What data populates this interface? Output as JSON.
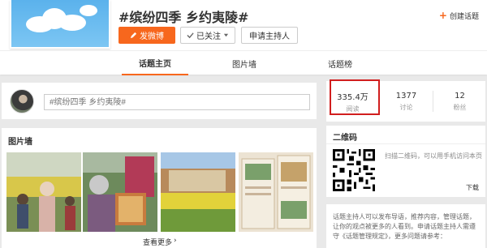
{
  "header": {
    "topic_title": "#缤纷四季 乡约夷陵#",
    "post_button": "发微博",
    "follow_button": "已关注",
    "host_button": "申请主持人",
    "create_topic": "创建话题"
  },
  "tabs": [
    {
      "label": "话题主页",
      "active": true
    },
    {
      "label": "图片墙",
      "active": false
    },
    {
      "label": "话题榜",
      "active": false
    }
  ],
  "composer": {
    "placeholder": "#缤纷四季 乡约夷陵#"
  },
  "photo_wall": {
    "title": "图片墙",
    "see_more": "查看更多",
    "see_more_arrow": "›"
  },
  "stats": [
    {
      "value": "335.4万",
      "label": "阅读"
    },
    {
      "value": "1377",
      "label": "讨论"
    },
    {
      "value": "12",
      "label": "粉丝"
    }
  ],
  "qr": {
    "title": "二维码",
    "description": "扫描二维码，可以用手机访问本页",
    "download": "下载"
  },
  "host": {
    "text": "话题主持人可以发布导语，推荐内容，管理话题，让你的观点被更多的人看到。申请话题主持人需遵守《话题管理规定》，更多问题请参考："
  },
  "colors": {
    "accent": "#f7671d",
    "highlight_box": "#d11e1e",
    "background": "#e9e9e9"
  },
  "icons": [
    "cloud-icon",
    "plus-icon",
    "pencil-icon",
    "check-icon",
    "caret-down-icon",
    "qr-code-icon"
  ]
}
